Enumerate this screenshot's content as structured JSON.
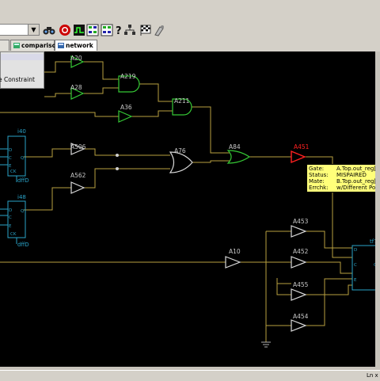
{
  "toolbar": {
    "icons": [
      "binoculars-icon",
      "stop-icon",
      "waveform-icon",
      "matrix-icon",
      "help-icon",
      "hierarchy-icon",
      "checker-flag-icon",
      "probe-icon"
    ]
  },
  "tabs": [
    {
      "label": "",
      "active": false
    },
    {
      "label": "comparison",
      "active": false
    },
    {
      "label": "network",
      "active": true
    }
  ],
  "menu": {
    "item_label": "e Constraint"
  },
  "schematic": {
    "colors": {
      "wire": "#b8a040",
      "gate": "#35c835",
      "mispaired": "#ff2020",
      "flop": "#2aa3c8",
      "label": "#c8c8c8"
    },
    "gates": [
      {
        "name": "A20"
      },
      {
        "name": "A28"
      },
      {
        "name": "A219"
      },
      {
        "name": "A36"
      },
      {
        "name": "A211"
      },
      {
        "name": "A506"
      },
      {
        "name": "A562"
      },
      {
        "name": "A76"
      },
      {
        "name": "A84"
      },
      {
        "name": "A451"
      },
      {
        "name": "A10"
      },
      {
        "name": "A453"
      },
      {
        "name": "A452"
      },
      {
        "name": "A455"
      },
      {
        "name": "A454"
      }
    ],
    "flops": [
      {
        "name": "i40",
        "pins": [
          "D",
          "C",
          "E",
          "Q",
          "CK"
        ],
        "cell": "dffD"
      },
      {
        "name": "i48",
        "pins": [
          "D",
          "C",
          "E",
          "Q",
          "CK"
        ],
        "cell": "dffD"
      },
      {
        "name": "tf7",
        "pins": [
          "D",
          "C",
          "E",
          "Q"
        ],
        "cell": ""
      }
    ]
  },
  "tooltip": {
    "rows": [
      {
        "key": "Gate:",
        "value": "A.Top.out_reg[7"
      },
      {
        "key": "Status:",
        "value": "MISPAIRED"
      },
      {
        "key": "Mate:",
        "value": "B.Top.out_reg[7"
      },
      {
        "key": "Errchk:",
        "value": "w/Different Port"
      }
    ]
  },
  "statusbar": {
    "text": "Ln x"
  }
}
